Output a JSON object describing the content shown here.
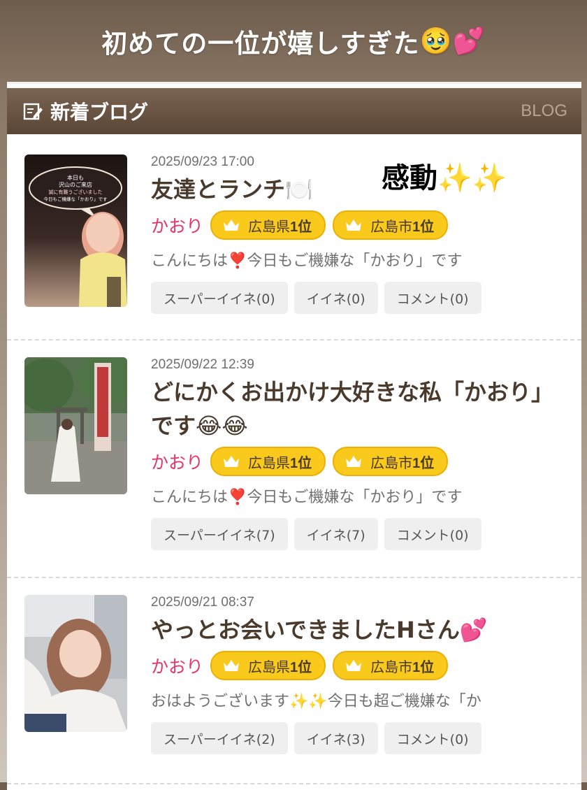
{
  "caption": {
    "text": "初めての一位が嬉しすぎた",
    "emoji": "🥹💕"
  },
  "header": {
    "title": "新着ブログ",
    "link": "BLOG"
  },
  "overlay": {
    "text": "感動",
    "emoji": "✨✨"
  },
  "posts": [
    {
      "date": "2025/09/23 17:00",
      "title": "友達とランチ🍽️",
      "author": "かおり",
      "badges": [
        {
          "region": "広島県",
          "rank": "1位"
        },
        {
          "region": "広島市",
          "rank": "1位"
        }
      ],
      "excerpt": "こんにちは❣️今日もご機嫌な「かおり」です",
      "buttons": [
        "スーパーイイネ(0)",
        "イイネ(0)",
        "コメント(0)"
      ],
      "thumb_text": [
        "本日も",
        "沢山のご来店",
        "誠に有難うございました",
        "今日もご機嫌な「かおり」です"
      ]
    },
    {
      "date": "2025/09/22 12:39",
      "title": "どにかくお出かけ大好きな私「かおり」です😂😂",
      "author": "かおり",
      "badges": [
        {
          "region": "広島県",
          "rank": "1位"
        },
        {
          "region": "広島市",
          "rank": "1位"
        }
      ],
      "excerpt": "こんにちは❣️今日もご機嫌な「かおり」です",
      "buttons": [
        "スーパーイイネ(7)",
        "イイネ(7)",
        "コメント(0)"
      ]
    },
    {
      "date": "2025/09/21 08:37",
      "title": "やっとお会いできましたHさん💕",
      "author": "かおり",
      "badges": [
        {
          "region": "広島県",
          "rank": "1位"
        },
        {
          "region": "広島市",
          "rank": "1位"
        }
      ],
      "excerpt": "おはようございます✨✨今日も超ご機嫌な「か",
      "buttons": [
        "スーパーイイネ(2)",
        "イイネ(3)",
        "コメント(0)"
      ]
    }
  ],
  "colors": {
    "accent": "#e6336b",
    "badge": "#f9c91b",
    "header": "#5a4636"
  }
}
